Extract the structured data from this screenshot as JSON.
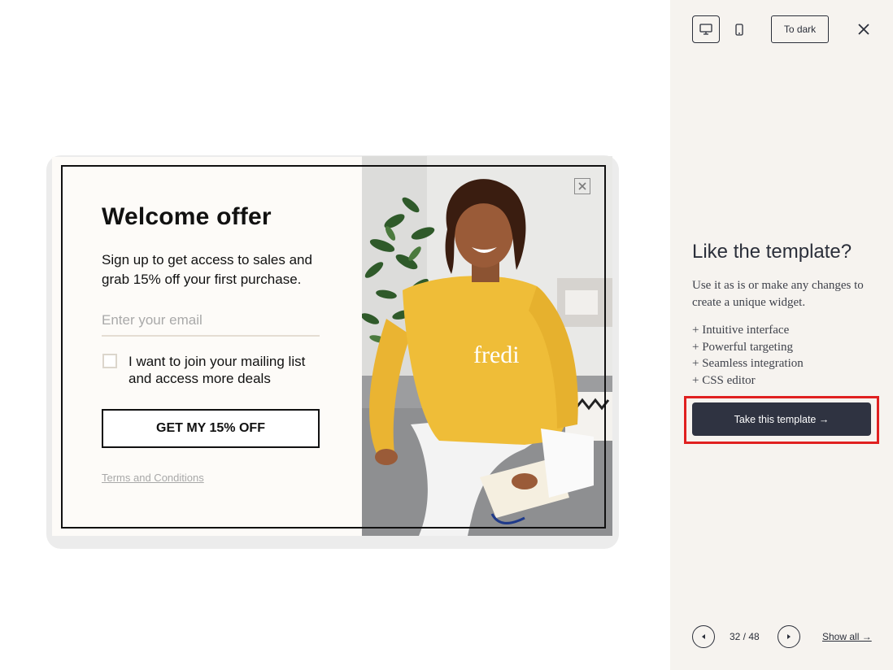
{
  "popup": {
    "title": "Welcome offer",
    "subtitle": "Sign up to get access to sales and grab 15% off your first purchase.",
    "email_placeholder": "Enter your email",
    "checkbox_label": "I want to join your mailing list and access more deals",
    "cta_label": "GET MY 15% OFF",
    "terms_link": "Terms and Conditions",
    "photo_brand_text": "fredi",
    "close_icon": "close-icon"
  },
  "panel": {
    "device_desktop_icon": "desktop-icon",
    "device_mobile_icon": "mobile-icon",
    "dark_toggle_label": "To dark",
    "close_icon": "close-icon",
    "like_title": "Like the template?",
    "like_description": "Use it as is or make any changes to create a unique widget.",
    "features": [
      "+ Intuitive interface",
      "+ Powerful targeting",
      "+ Seamless integration",
      "+ CSS editor"
    ],
    "take_button_label": "Take this template →",
    "counter": "32 / 48",
    "show_all_label": "Show all →",
    "highlight_color": "#e02020",
    "button_color": "#2f3341"
  }
}
